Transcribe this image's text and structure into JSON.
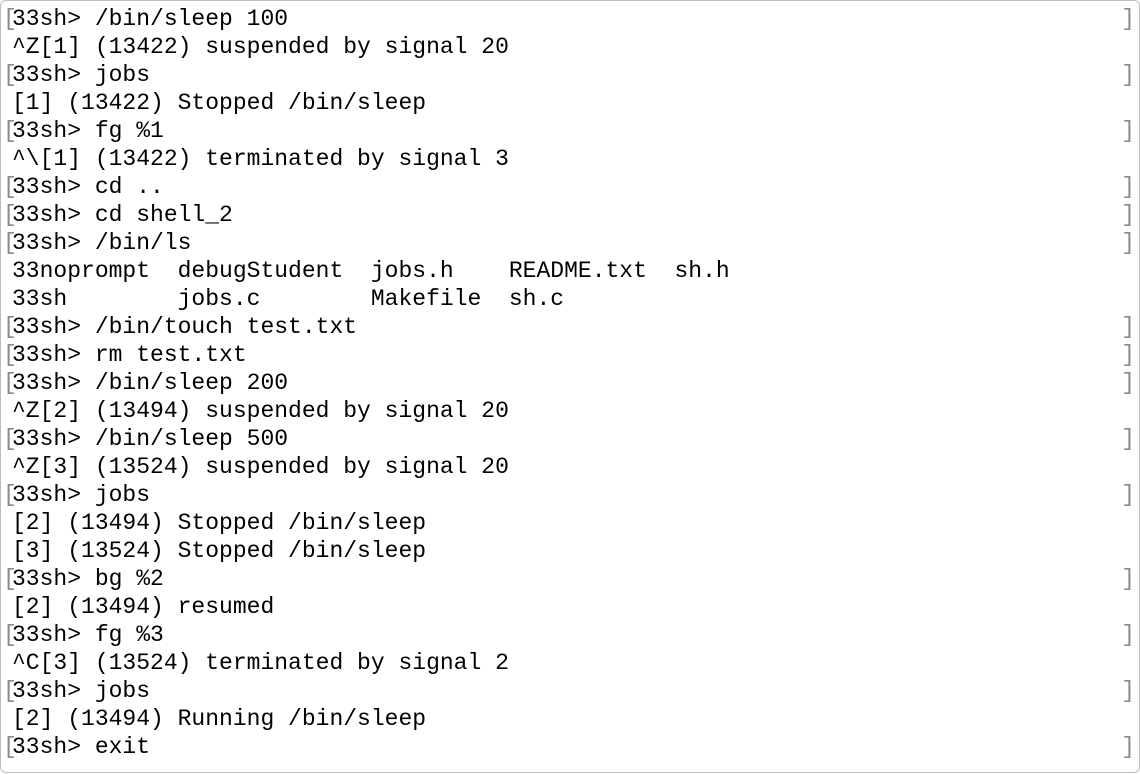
{
  "terminal": {
    "bracket_open": "[",
    "bracket_close": "]",
    "lines": [
      {
        "prompt": true,
        "text": "33sh> /bin/sleep 100"
      },
      {
        "prompt": false,
        "text": "^Z[1] (13422) suspended by signal 20"
      },
      {
        "prompt": true,
        "text": "33sh> jobs"
      },
      {
        "prompt": false,
        "text": "[1] (13422) Stopped /bin/sleep"
      },
      {
        "prompt": true,
        "text": "33sh> fg %1"
      },
      {
        "prompt": false,
        "text": "^\\[1] (13422) terminated by signal 3"
      },
      {
        "prompt": true,
        "text": "33sh> cd .."
      },
      {
        "prompt": true,
        "text": "33sh> cd shell_2"
      },
      {
        "prompt": true,
        "text": "33sh> /bin/ls"
      },
      {
        "prompt": false,
        "text": "33noprompt  debugStudent  jobs.h    README.txt  sh.h"
      },
      {
        "prompt": false,
        "text": "33sh        jobs.c        Makefile  sh.c"
      },
      {
        "prompt": true,
        "text": "33sh> /bin/touch test.txt"
      },
      {
        "prompt": true,
        "text": "33sh> rm test.txt"
      },
      {
        "prompt": true,
        "text": "33sh> /bin/sleep 200"
      },
      {
        "prompt": false,
        "text": "^Z[2] (13494) suspended by signal 20"
      },
      {
        "prompt": true,
        "text": "33sh> /bin/sleep 500"
      },
      {
        "prompt": false,
        "text": "^Z[3] (13524) suspended by signal 20"
      },
      {
        "prompt": true,
        "text": "33sh> jobs"
      },
      {
        "prompt": false,
        "text": "[2] (13494) Stopped /bin/sleep"
      },
      {
        "prompt": false,
        "text": "[3] (13524) Stopped /bin/sleep"
      },
      {
        "prompt": true,
        "text": "33sh> bg %2"
      },
      {
        "prompt": false,
        "text": "[2] (13494) resumed"
      },
      {
        "prompt": true,
        "text": "33sh> fg %3"
      },
      {
        "prompt": false,
        "text": "^C[3] (13524) terminated by signal 2"
      },
      {
        "prompt": true,
        "text": "33sh> jobs"
      },
      {
        "prompt": false,
        "text": "[2] (13494) Running /bin/sleep"
      },
      {
        "prompt": true,
        "text": "33sh> exit"
      }
    ]
  }
}
